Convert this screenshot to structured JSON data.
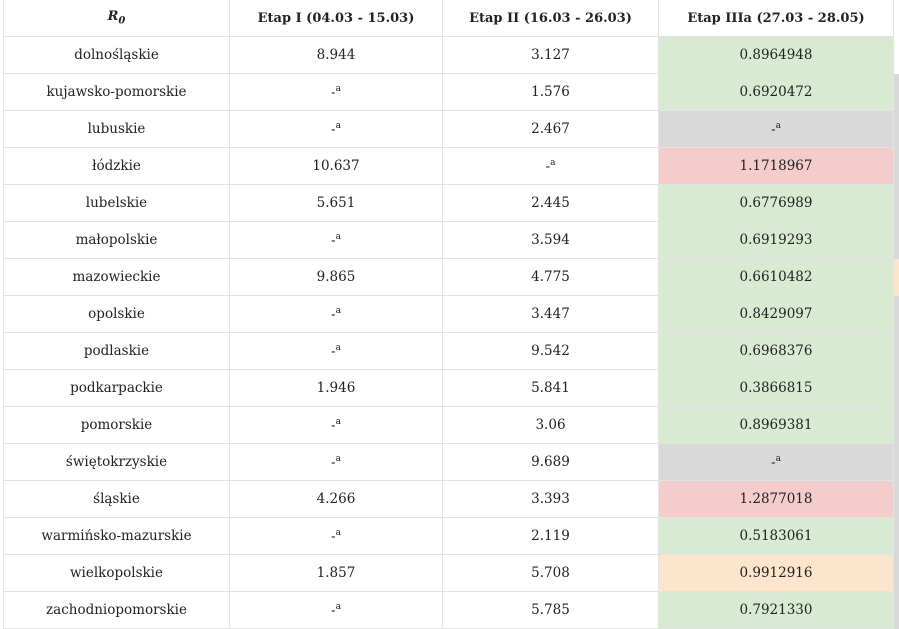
{
  "table": {
    "header": {
      "r0_main": "R",
      "r0_sub": "0",
      "col1": "Etap I (04.03 - 15.03)",
      "col2": "Etap II (16.03 - 26.03)",
      "col3": "Etap IIIa (27.03 - 28.05)"
    },
    "na": {
      "dash": "-",
      "sup": "a"
    },
    "colors": {
      "green": "#d9ead3",
      "red": "#f4cccc",
      "grey": "#d9d9d9",
      "orange": "#fce5cd"
    },
    "rows": [
      {
        "region": "dolnośląskie",
        "e1": "8.944",
        "e2": "3.127",
        "e3": "0.8964948",
        "e3_color": "green",
        "e1_na": false,
        "e2_na": false,
        "e3_na": false
      },
      {
        "region": "kujawsko-pomorskie",
        "e1": "",
        "e2": "1.576",
        "e3": "0.6920472",
        "e3_color": "green",
        "e1_na": true,
        "e2_na": false,
        "e3_na": false
      },
      {
        "region": "lubuskie",
        "e1": "",
        "e2": "2.467",
        "e3": "",
        "e3_color": "grey",
        "e1_na": true,
        "e2_na": false,
        "e3_na": true
      },
      {
        "region": "łódzkie",
        "e1": "10.637",
        "e2": "",
        "e3": "1.1718967",
        "e3_color": "red",
        "e1_na": false,
        "e2_na": true,
        "e3_na": false
      },
      {
        "region": "lubelskie",
        "e1": "5.651",
        "e2": "2.445",
        "e3": "0.6776989",
        "e3_color": "green",
        "e1_na": false,
        "e2_na": false,
        "e3_na": false
      },
      {
        "region": "małopolskie",
        "e1": "",
        "e2": "3.594",
        "e3": "0.6919293",
        "e3_color": "green",
        "e1_na": true,
        "e2_na": false,
        "e3_na": false
      },
      {
        "region": "mazowieckie",
        "e1": "9.865",
        "e2": "4.775",
        "e3": "0.6610482",
        "e3_color": "green",
        "e1_na": false,
        "e2_na": false,
        "e3_na": false
      },
      {
        "region": "opolskie",
        "e1": "",
        "e2": "3.447",
        "e3": "0.8429097",
        "e3_color": "green",
        "e1_na": true,
        "e2_na": false,
        "e3_na": false
      },
      {
        "region": "podlaskie",
        "e1": "",
        "e2": "9.542",
        "e3": "0.6968376",
        "e3_color": "green",
        "e1_na": true,
        "e2_na": false,
        "e3_na": false
      },
      {
        "region": "podkarpackie",
        "e1": "1.946",
        "e2": "5.841",
        "e3": "0.3866815",
        "e3_color": "green",
        "e1_na": false,
        "e2_na": false,
        "e3_na": false
      },
      {
        "region": "pomorskie",
        "e1": "",
        "e2": "3.06",
        "e3": "0.8969381",
        "e3_color": "green",
        "e1_na": true,
        "e2_na": false,
        "e3_na": false
      },
      {
        "region": "świętokrzyskie",
        "e1": "",
        "e2": "9.689",
        "e3": "",
        "e3_color": "grey",
        "e1_na": true,
        "e2_na": false,
        "e3_na": true
      },
      {
        "region": "śląskie",
        "e1": "4.266",
        "e2": "3.393",
        "e3": "1.2877018",
        "e3_color": "red",
        "e1_na": false,
        "e2_na": false,
        "e3_na": false
      },
      {
        "region": "warmińsko-mazurskie",
        "e1": "",
        "e2": "2.119",
        "e3": "0.5183061",
        "e3_color": "green",
        "e1_na": true,
        "e2_na": false,
        "e3_na": false
      },
      {
        "region": "wielkopolskie",
        "e1": "1.857",
        "e2": "5.708",
        "e3": "0.9912916",
        "e3_color": "orange",
        "e1_na": false,
        "e2_na": false,
        "e3_na": false
      },
      {
        "region": "zachodniopomorskie",
        "e1": "",
        "e2": "5.785",
        "e3": "0.7921330",
        "e3_color": "green",
        "e1_na": true,
        "e2_na": false,
        "e3_na": false
      }
    ],
    "strip_colors": [
      "white",
      "grey",
      "grey",
      "grey",
      "grey",
      "grey",
      "orange",
      "grey",
      "grey",
      "grey",
      "grey",
      "grey",
      "grey",
      "grey",
      "grey",
      "grey"
    ]
  }
}
